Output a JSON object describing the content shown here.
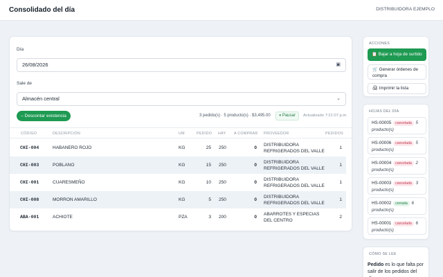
{
  "header": {
    "title": "Consolidado del día",
    "company": "DISTRIBUIDORA EJEMPLO"
  },
  "form": {
    "date_label": "Día",
    "date_value": "26/08/2026",
    "source_label": "Sale de",
    "source_value": "Almacén central"
  },
  "toolbar": {
    "descontar_label": "– Descontar existencia",
    "summary": "3 pedido(s) · 5 producto(s) · $3,495.00",
    "pause_label": "⏸ Pausar",
    "updated": "Actualizado 7:21:07 p.m."
  },
  "table": {
    "columns": [
      "CÓDIGO",
      "DESCRIPCIÓN",
      "UM",
      "PEDIDO",
      "HAY",
      "A COMPRAR",
      "PROVEEDOR",
      "PEDIDOS"
    ],
    "rows": [
      {
        "code": "CHI-004",
        "desc": "HABANERO ROJO",
        "um": "KG",
        "pedido": "25",
        "hay": "250",
        "comprar": "0",
        "prov1": "DISTRIBUIDORA",
        "prov2": "REFRIGERADOS DEL VALLE",
        "pedidos": "1"
      },
      {
        "code": "CHI-003",
        "desc": "POBLANO",
        "um": "KG",
        "pedido": "15",
        "hay": "250",
        "comprar": "0",
        "prov1": "DISTRIBUIDORA",
        "prov2": "REFRIGERADOS DEL VALLE",
        "pedidos": "1"
      },
      {
        "code": "CHI-001",
        "desc": "CUARESMEÑO",
        "um": "KG",
        "pedido": "10",
        "hay": "250",
        "comprar": "0",
        "prov1": "DISTRIBUIDORA",
        "prov2": "REFRIGERADOS DEL VALLE",
        "pedidos": "1"
      },
      {
        "code": "CHI-008",
        "desc": "MORRON AMARILLO",
        "um": "KG",
        "pedido": "5",
        "hay": "250",
        "comprar": "0",
        "prov1": "DISTRIBUIDORA",
        "prov2": "REFRIGERADOS DEL VALLE",
        "pedidos": "1"
      },
      {
        "code": "ABA-001",
        "desc": "ACHIOTE",
        "um": "PZA",
        "pedido": "3",
        "hay": "200",
        "comprar": "0",
        "prov1": "ABARROTES Y ESPECIAS",
        "prov2": "DEL CENTRO",
        "pedidos": "2"
      }
    ]
  },
  "acciones": {
    "title": "ACCIONES",
    "bajar": "📋 Bajar a hoja de surtido",
    "generar": "🛒 Generar órdenes de compra",
    "imprimir": "🖨 Imprimir la lista"
  },
  "hojas": {
    "title": "HOJAS DEL DÍA",
    "items": [
      {
        "id": "HS-00005",
        "status": "cancelada",
        "count": "5",
        "unit": "producto(s)"
      },
      {
        "id": "HS-00006",
        "status": "cancelada",
        "count": "5",
        "unit": "producto(s)"
      },
      {
        "id": "HS-00004",
        "status": "cancelada",
        "count": "2",
        "unit": "producto(s)"
      },
      {
        "id": "HS-00003",
        "status": "cancelada",
        "count": "3",
        "unit": "producto(s)"
      },
      {
        "id": "HS-00002",
        "status": "cerrada",
        "count": "6",
        "unit": "producto(s)"
      },
      {
        "id": "HS-00001",
        "status": "cancelada",
        "count": "6",
        "unit": "producto(s)"
      }
    ]
  },
  "como": {
    "title": "CÓMO SE LEE",
    "bold": "Pedido",
    "text": " es lo que falta por salir de los pedidos del día."
  },
  "colors": {
    "accent": "#1e9a52",
    "cancel": "#c0394f",
    "closed": "#1e7a45"
  },
  "icons": {
    "calendar": "calendar-icon",
    "chevron": "chevron-down-icon",
    "pause": "pause-icon"
  }
}
